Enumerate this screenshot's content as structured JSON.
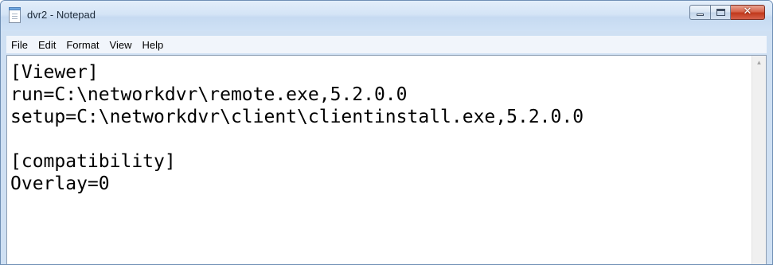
{
  "window": {
    "title": "dvr2 - Notepad"
  },
  "icons": {
    "app": "notepad-icon",
    "minimize": "minimize-icon",
    "maximize": "maximize-icon",
    "close": "close-icon",
    "scroll_up": "scroll-up-arrow-icon"
  },
  "caption": {
    "close_glyph": "✕",
    "scroll_up_glyph": "▲"
  },
  "menu": {
    "items": [
      {
        "label": "File"
      },
      {
        "label": "Edit"
      },
      {
        "label": "Format"
      },
      {
        "label": "View"
      },
      {
        "label": "Help"
      }
    ]
  },
  "editor": {
    "content": "[Viewer]\nrun=C:\\networkdvr\\remote.exe,5.2.0.0\nsetup=C:\\networkdvr\\client\\clientinstall.exe,5.2.0.0\n\n[compatibility]\nOverlay=0"
  },
  "colors": {
    "close_button": "#c2391c",
    "frame": "#cfe0f3"
  }
}
